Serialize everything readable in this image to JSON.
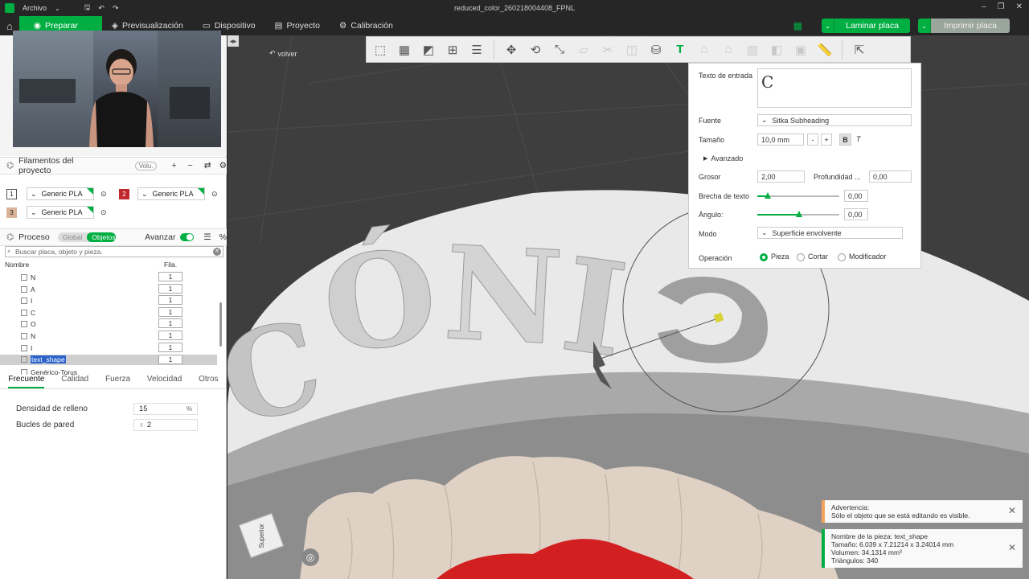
{
  "window": {
    "menu_label": "Archivo",
    "title": "reduced_color_260218004408_FPNL"
  },
  "nav": {
    "tabs": [
      {
        "label": "Preparar"
      },
      {
        "label": "Previsualización"
      },
      {
        "label": "Dispositivo"
      },
      {
        "label": "Proyecto"
      },
      {
        "label": "Calibración"
      }
    ],
    "slice_label": "Laminar placa",
    "print_label": "Imprimir placa"
  },
  "filaments": {
    "header": "Filamentos del proyecto",
    "volumetric_label": "Volu.",
    "items": [
      {
        "num": "1",
        "name": "Generic PLA",
        "color": "#ffffff"
      },
      {
        "num": "2",
        "name": "Generic PLA",
        "color": "#c0282d"
      },
      {
        "num": "3",
        "name": "Generic PLA",
        "color": "#d9b49a"
      }
    ]
  },
  "process": {
    "header": "Proceso",
    "seg_global": "Global",
    "seg_objects": "Objetos",
    "advanced_label": "Avanzar",
    "search_placeholder": "Buscar placa, objeto y pieza.",
    "col_name": "Nombre",
    "col_fil": "Fila.",
    "rows": [
      {
        "name": "N",
        "fil": "1"
      },
      {
        "name": "A",
        "fil": "1"
      },
      {
        "name": "I",
        "fil": "1"
      },
      {
        "name": "C",
        "fil": "1"
      },
      {
        "name": "O",
        "fil": "1"
      },
      {
        "name": "N",
        "fil": "1"
      },
      {
        "name": "I",
        "fil": "1"
      },
      {
        "name": "text_shape",
        "fil": "1"
      },
      {
        "name": "Genérico-Torus",
        "fil": ""
      }
    ]
  },
  "param_tabs": [
    "Frecuente",
    "Calidad",
    "Fuerza",
    "Velocidad",
    "Otros"
  ],
  "params": {
    "infill_label": "Densidad de relleno",
    "infill_value": "15",
    "infill_unit": "%",
    "walls_label": "Bucles de pared",
    "walls_value": "2"
  },
  "viewport": {
    "back_label": "volver",
    "view_cube_label": "Superior",
    "embossed_text": "CÓNIC"
  },
  "text_panel": {
    "input_label": "Texto de entrada",
    "input_value": "C",
    "font_label": "Fuente",
    "font_value": "Sitka Subheading",
    "size_label": "Tamaño",
    "size_value": "10,0 mm",
    "size_minus": "-",
    "size_plus": "+",
    "bold_label": "B",
    "italic_label": "T",
    "advanced_label": "Avanzado",
    "thickness_label": "Grosor",
    "thickness_value": "2,00",
    "depth_label": "Profundidad ...",
    "depth_value": "0,00",
    "gap_label": "Brecha de texto",
    "gap_value": "0,00",
    "angle_label": "Ángulo:",
    "angle_value": "0,00",
    "mode_label": "Modo",
    "mode_value": "Superficie envolvente",
    "operation_label": "Operación",
    "op_part": "Pieza",
    "op_cut": "Cortar",
    "op_modifier": "Modificador"
  },
  "toasts": {
    "warning_title": "Advertencia:",
    "warning_text": "Sólo el objeto que se está editando es visible.",
    "info_name": "Nombre de la pieza: text_shape",
    "info_size": "Tamaño: 6.039 x 7.21214 x 3.24014 mm",
    "info_volume": "Volumen: 34.1314 mm³",
    "info_triangles": "Triángulos: 340"
  },
  "colors": {
    "accent": "#00ae42",
    "warning": "#f5a25a",
    "gum": "#d21f1f",
    "teeth": "#e2d3c8"
  }
}
